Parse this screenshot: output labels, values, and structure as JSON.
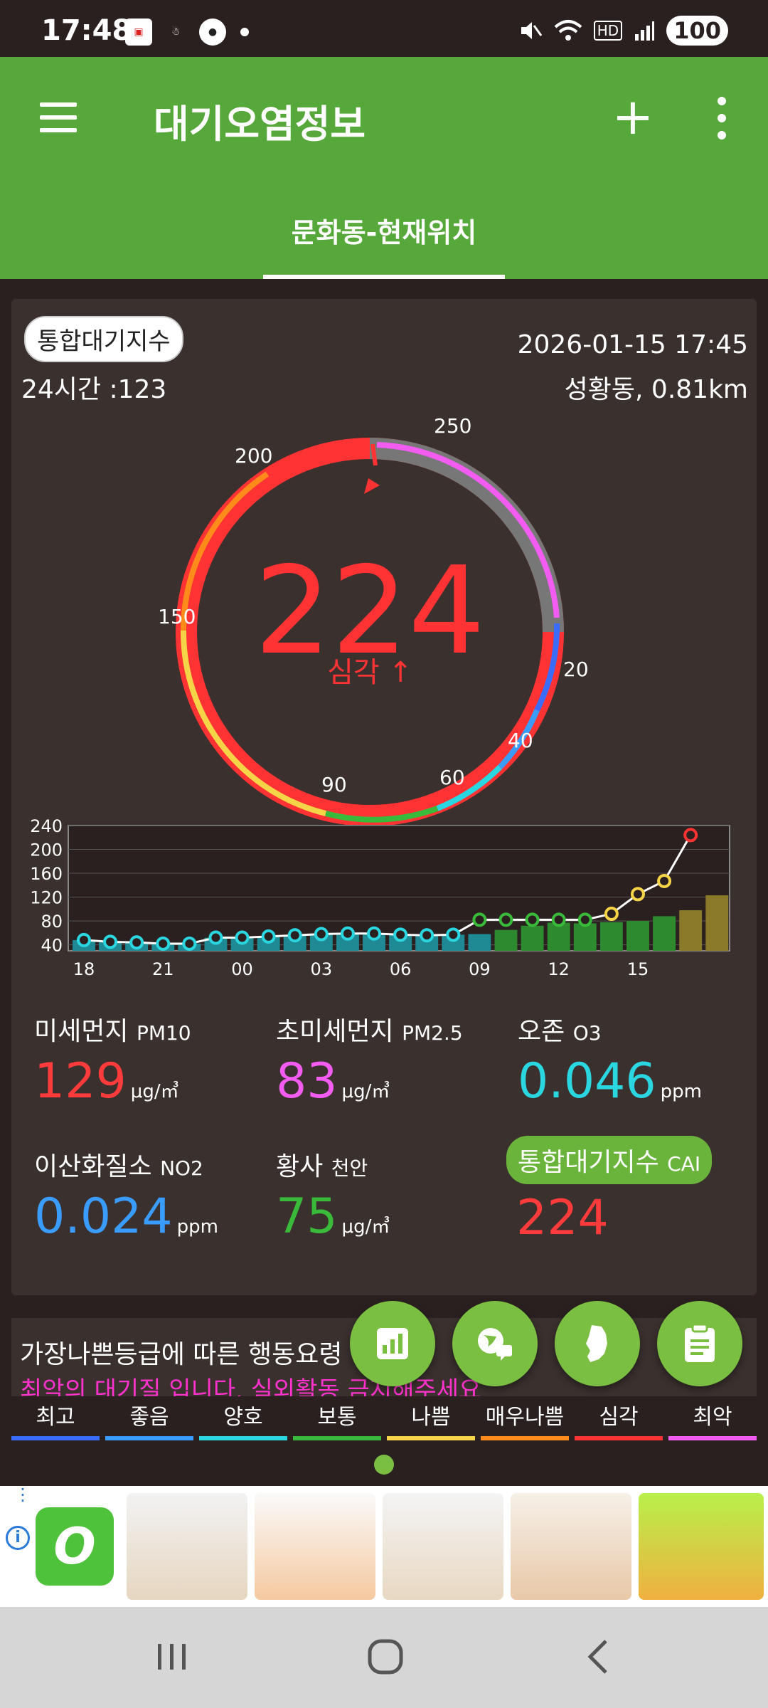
{
  "status": {
    "time": "17:48",
    "battery": "100"
  },
  "app": {
    "title": "대기오염정보",
    "tab_location": "문화동-현재위치"
  },
  "summary": {
    "cai_label": "통합대기지수",
    "h24": "24시간 :123",
    "datetime": "2026-01-15 17:45",
    "station": "성황동, 0.81km"
  },
  "gauge": {
    "value": "224",
    "grade": "심각 ↑",
    "ticks": [
      "20",
      "40",
      "60",
      "90",
      "150",
      "200",
      "250"
    ],
    "colors": {
      "value": "#ff3333",
      "ring_bad": "#ff3333",
      "ring_rest": "#777777"
    }
  },
  "chart_data": {
    "type": "bar",
    "ylim": [
      30,
      240
    ],
    "yticks": [
      "240",
      "200",
      "160",
      "120",
      "80",
      "40"
    ],
    "xtick_labels": [
      "18",
      "21",
      "00",
      "03",
      "06",
      "09",
      "12",
      "15"
    ],
    "values": [
      48,
      45,
      44,
      42,
      42,
      52,
      52,
      54,
      56,
      58,
      59,
      59,
      57,
      56,
      57,
      58,
      65,
      72,
      77,
      76,
      78,
      80,
      88,
      98,
      123
    ],
    "line_values": [
      48,
      45,
      44,
      42,
      42,
      52,
      52,
      54,
      56,
      58,
      59,
      59,
      57,
      56,
      57,
      82,
      82,
      82,
      82,
      82,
      92,
      125,
      147,
      224
    ],
    "marker_colors": [
      "#2ad7e0",
      "#2ad7e0",
      "#2ad7e0",
      "#2ad7e0",
      "#2ad7e0",
      "#2ad7e0",
      "#2ad7e0",
      "#2ad7e0",
      "#2ad7e0",
      "#2ad7e0",
      "#2ad7e0",
      "#2ad7e0",
      "#2ad7e0",
      "#2ad7e0",
      "#2ad7e0",
      "#3aba3a",
      "#3aba3a",
      "#3aba3a",
      "#3aba3a",
      "#3aba3a",
      "#f5d547",
      "#f5d547",
      "#f5d547",
      "#ff3333"
    ]
  },
  "pollutants": {
    "pm10": {
      "name": "미세먼지",
      "sub": "PM10",
      "value": "129",
      "unit": "μg/㎥",
      "color": "#ff3b3b"
    },
    "pm25": {
      "name": "초미세먼지",
      "sub": "PM2.5",
      "value": "83",
      "unit": "μg/㎥",
      "color": "#f25cf0"
    },
    "o3": {
      "name": "오존",
      "sub": "O3",
      "value": "0.046",
      "unit": "ppm",
      "color": "#2ad7e0"
    },
    "no2": {
      "name": "이산화질소",
      "sub": "NO2",
      "value": "0.024",
      "unit": "ppm",
      "color": "#3a9cff"
    },
    "dust": {
      "name": "황사",
      "sub": "천안",
      "value": "75",
      "unit": "μg/㎥",
      "color": "#3aba3a"
    },
    "cai": {
      "name": "통합대기지수",
      "sub": "CAI",
      "value": "224",
      "color": "#ff3b3b"
    }
  },
  "action": {
    "title": "가장나쁜등급에 따른 행동요령",
    "desc": "최악의 대기질 입니다. 실외활동 금지해주세요"
  },
  "legend": [
    {
      "label": "최고",
      "color": "#3a6cff"
    },
    {
      "label": "좋음",
      "color": "#3a9cff"
    },
    {
      "label": "양호",
      "color": "#2ad7e0"
    },
    {
      "label": "보통",
      "color": "#3aba3a"
    },
    {
      "label": "나쁨",
      "color": "#f5d547"
    },
    {
      "label": "매우나쁨",
      "color": "#ff8c1a"
    },
    {
      "label": "심각",
      "color": "#ff3333"
    },
    {
      "label": "최악",
      "color": "#f25cf0"
    }
  ]
}
